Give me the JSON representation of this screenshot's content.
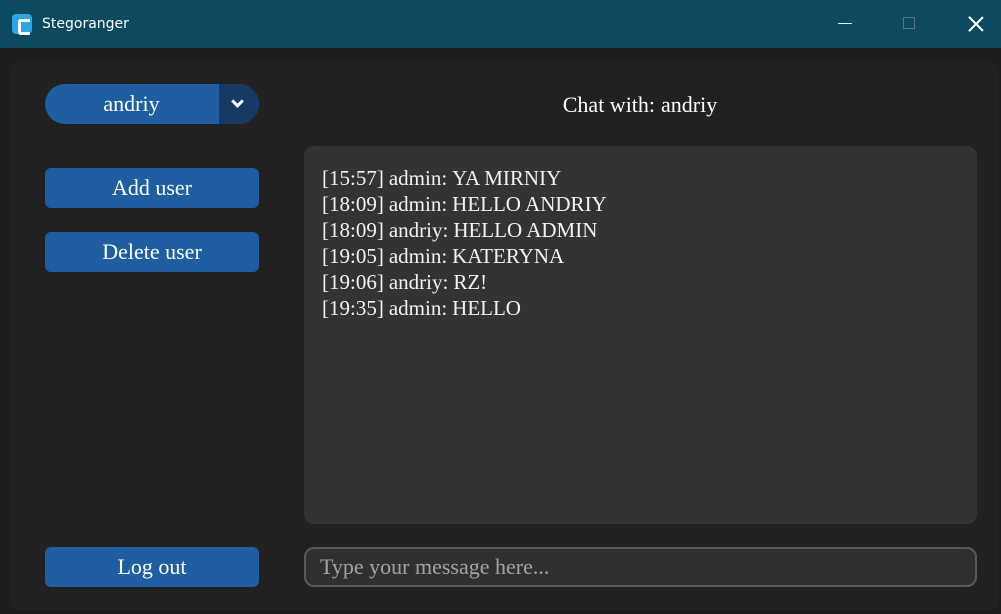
{
  "window": {
    "title": "Stegoranger",
    "icon": "stegoranger-app-icon",
    "controls": [
      "minimize-icon",
      "maximize-icon",
      "close-icon"
    ]
  },
  "sidebar": {
    "user_select": {
      "value": "andriy",
      "icon": "chevron-down-icon"
    },
    "add_user_label": "Add user",
    "delete_user_label": "Delete user",
    "logout_label": "Log out"
  },
  "chat": {
    "title_prefix": "Chat with:",
    "partner": "andriy",
    "messages": [
      {
        "time": "[15:57]",
        "sender": "admin:",
        "text": "YA MIRNIY"
      },
      {
        "time": "[18:09]",
        "sender": "admin:",
        "text": "HELLO ANDRIY"
      },
      {
        "time": "[18:09]",
        "sender": "andriy:",
        "text": "HELLO ADMIN"
      },
      {
        "time": "[19:05]",
        "sender": "admin:",
        "text": "KATERYNA"
      },
      {
        "time": "[19:06]",
        "sender": "andriy:",
        "text": "RZ!"
      },
      {
        "time": "[19:35]",
        "sender": "admin:",
        "text": "HELLO"
      }
    ],
    "input": {
      "value": "",
      "placeholder": "Type your message here..."
    }
  },
  "colors": {
    "titlebar": "#0d4a61",
    "accent": "#1f5fa1",
    "accent_dark": "#153a64",
    "panel": "#333333",
    "background": "#212121"
  }
}
